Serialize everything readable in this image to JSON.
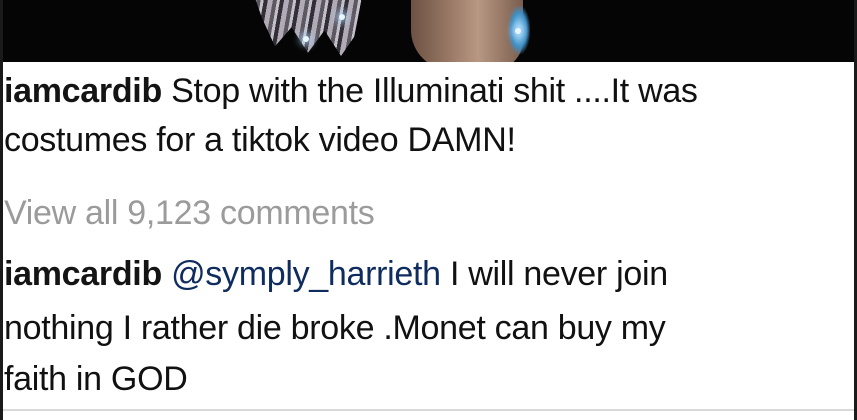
{
  "post": {
    "media_label": "post-photo",
    "caption": {
      "username": "iamcardib",
      "line1_text": "Stop with the Illuminati shit ....It was",
      "line2_text": "costumes for a tiktok video DAMN!"
    },
    "view_comments_label": "View all 9,123 comments"
  },
  "comment": {
    "username": "iamcardib",
    "mention": "@symply_harrieth",
    "line1_text": "I will never join",
    "line2_text": "nothing I rather die broke .Monet can buy my",
    "line3_text": "faith in GOD"
  },
  "colors": {
    "text": "#111111",
    "muted": "#9b9b9b",
    "mention": "#0f2c5e",
    "frame": "#1a1a1a"
  }
}
